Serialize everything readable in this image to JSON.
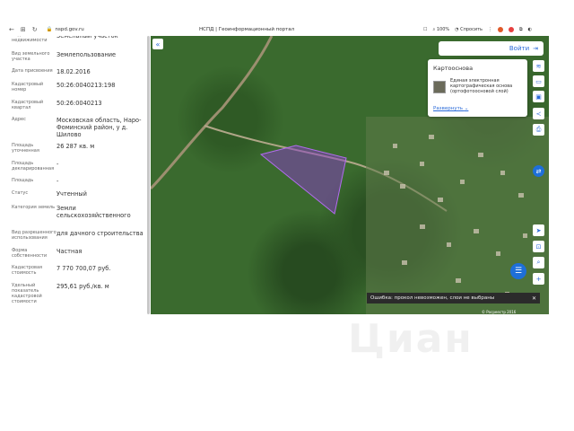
{
  "browser": {
    "url": "nspd.gov.ru",
    "title": "НСПД | Геоинформационный портал",
    "zoom": "100%",
    "ask_label": "Спросить"
  },
  "object": {
    "fields": [
      {
        "label": "Вид объекта недвижимости",
        "value": "Земельный участок"
      },
      {
        "label": "Вид земельного участка",
        "value": "Землепользование"
      },
      {
        "label": "Дата присвоения",
        "value": "18.02.2016"
      },
      {
        "label": "Кадастровый номер",
        "value": "50:26:0040213:198"
      },
      {
        "label": "Кадастровый квартал",
        "value": "50:26:0040213"
      },
      {
        "label": "Адрес",
        "value": "Московская область, Наро-Фоминский район, у д. Шилово"
      },
      {
        "label": "Площадь уточненная",
        "value": "26 287 кв. м"
      },
      {
        "label": "Площадь декларированная",
        "value": "-"
      },
      {
        "label": "Площадь",
        "value": "-"
      },
      {
        "label": "Статус",
        "value": "Учтенный"
      },
      {
        "label": "Категория земель",
        "value": "Земли сельскохозяйственного назначения"
      },
      {
        "label": "Вид разрешенного использования",
        "value": "для дачного строительства"
      },
      {
        "label": "Форма собственности",
        "value": "Частная"
      },
      {
        "label": "Кадастровая стоимость",
        "value": "7 770 700,07 руб."
      },
      {
        "label": "Удельный показатель кадастровой стоимости",
        "value": "295,61 руб./кв. м"
      }
    ]
  },
  "map": {
    "login_label": "Войти",
    "basemap_card": {
      "title": "Картооснова",
      "description": "Единая электронная картографическая основа (ортофотоосновой слой)",
      "expand_link": "Развернуть"
    },
    "error_message": "Ошибка: прокол невозможен, слои не выбраны",
    "scale_text": "© Росреестр 2016",
    "parcel_color": "#8a3cc8"
  },
  "watermark": "Циан"
}
